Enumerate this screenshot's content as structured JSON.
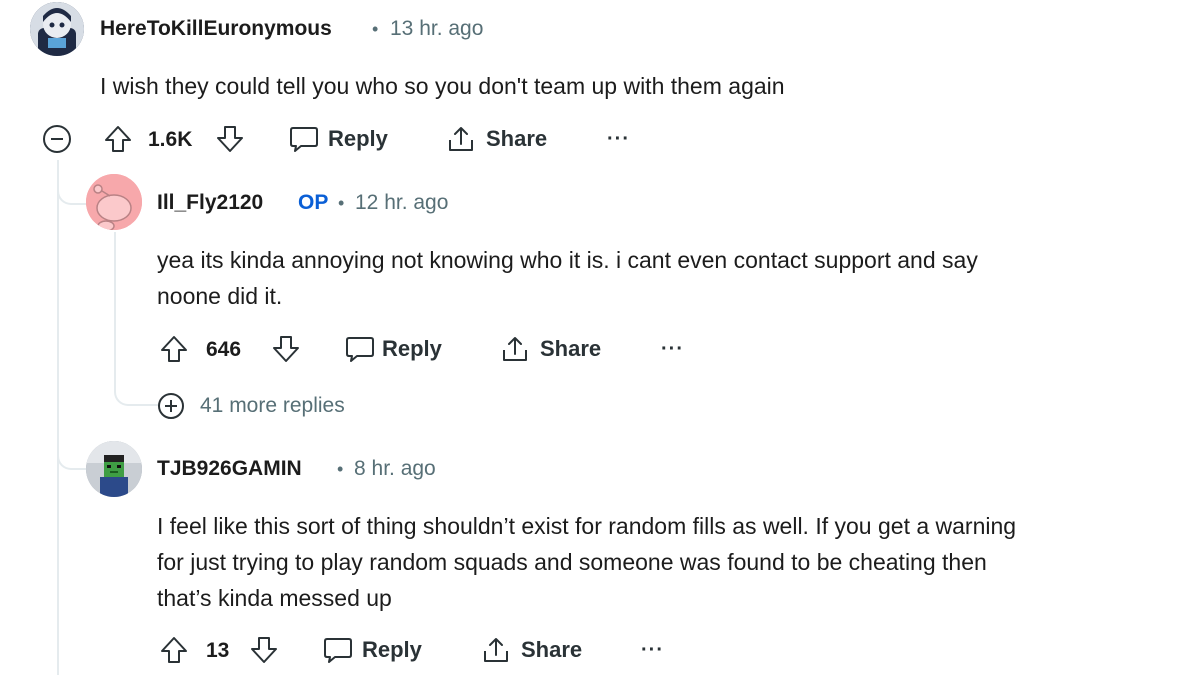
{
  "comments": [
    {
      "username": "HereToKillEuronymous",
      "time": "13 hr. ago",
      "body": [
        "I wish they could tell you who so you don't team up with them again"
      ],
      "votes": "1.6K",
      "reply_label": "Reply",
      "share_label": "Share",
      "more_label": "···"
    },
    {
      "username": "Ill_Fly2120",
      "badge": "OP",
      "time": "12 hr. ago",
      "body": [
        "yea its kinda annoying not knowing who it is. i cant even contact support and say",
        "noone did it."
      ],
      "votes": "646",
      "reply_label": "Reply",
      "share_label": "Share",
      "more_label": "···"
    },
    {
      "username": "TJB926GAMIN",
      "time": "8 hr. ago",
      "body": [
        "I feel like this sort of thing shouldn’t exist for random fills as well. If you get a warning",
        "for just trying to play random squads and someone was found to be cheating then",
        "that’s kinda messed up"
      ],
      "votes": "13",
      "reply_label": "Reply",
      "share_label": "Share",
      "more_label": "···"
    }
  ],
  "more_replies": "41 more replies",
  "separator": "•",
  "icons": {
    "collapse": "minus-circle-icon",
    "expand": "plus-circle-icon",
    "upvote": "arrow-up-icon",
    "downvote": "arrow-down-icon",
    "reply": "speech-bubble-icon",
    "share": "share-icon"
  },
  "colors": {
    "op_badge": "#0a5fd6",
    "meta_text": "#576f76",
    "thread_line": "#e5ebee"
  }
}
